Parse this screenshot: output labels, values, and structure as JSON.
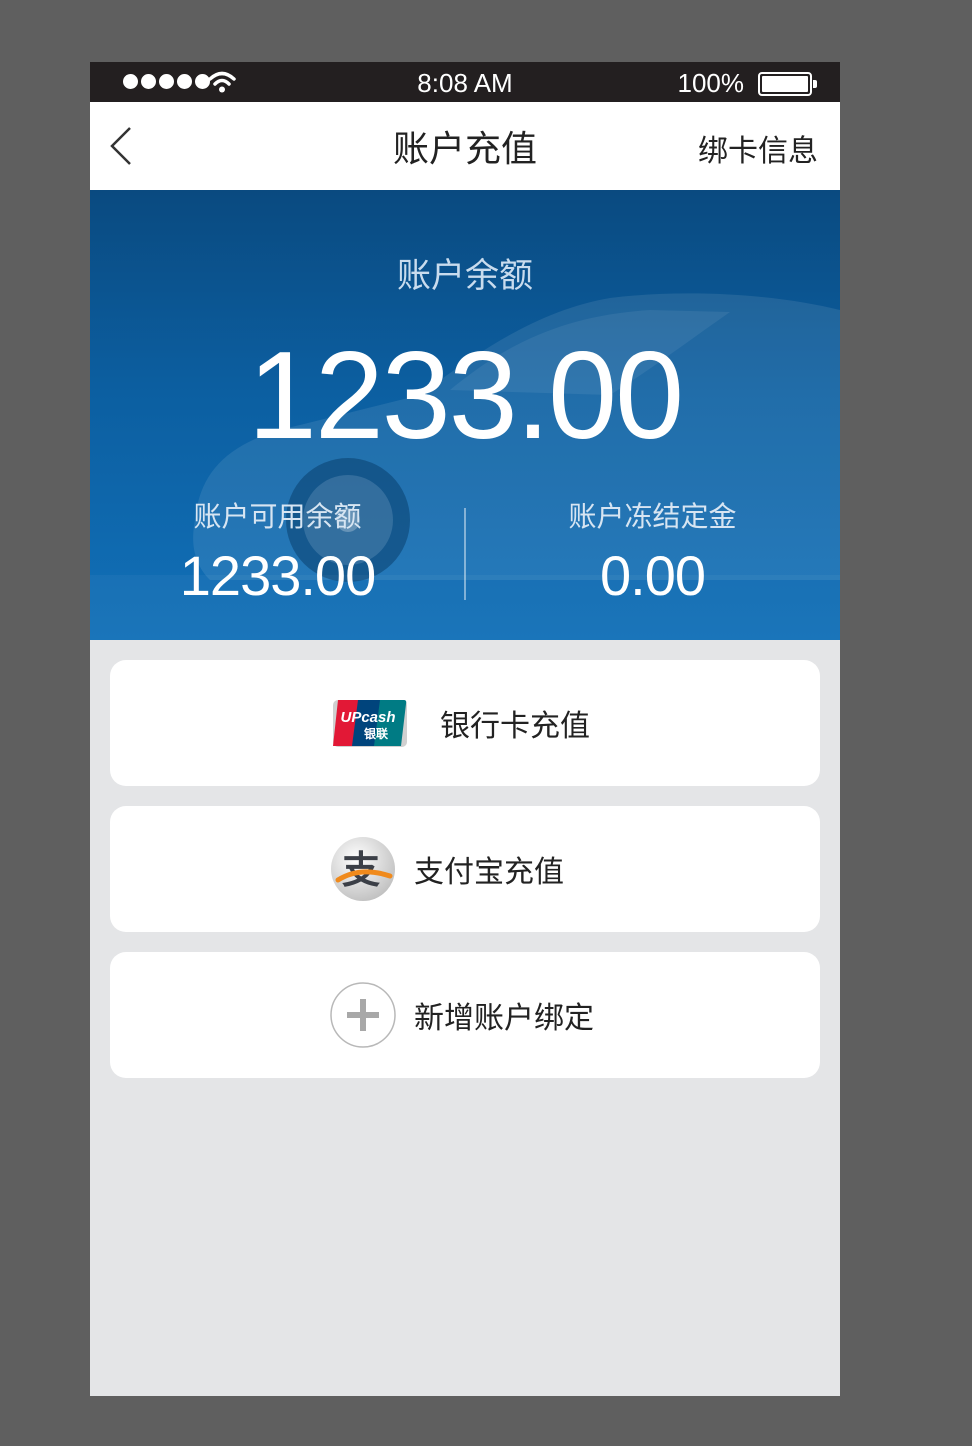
{
  "statusbar": {
    "time": "8:08 AM",
    "battery_pct": "100%"
  },
  "navbar": {
    "title": "账户充值",
    "right_action": "绑卡信息"
  },
  "balance": {
    "label": "账户余额",
    "amount": "1233.00",
    "available_label": "账户可用余额",
    "available_value": "1233.00",
    "frozen_label": "账户冻结定金",
    "frozen_value": "0.00"
  },
  "options": [
    {
      "label": "银行卡充值",
      "icon": "unionpay-icon",
      "icon_text_top": "UPcash",
      "icon_text_bottom": "银联"
    },
    {
      "label": "支付宝充值",
      "icon": "alipay-icon",
      "icon_glyph": "支"
    },
    {
      "label": "新增账户绑定",
      "icon": "plus-icon"
    }
  ],
  "colors": {
    "banner": "#0c5fa1",
    "background": "#e4e5e7",
    "statusbar": "#231f20"
  }
}
